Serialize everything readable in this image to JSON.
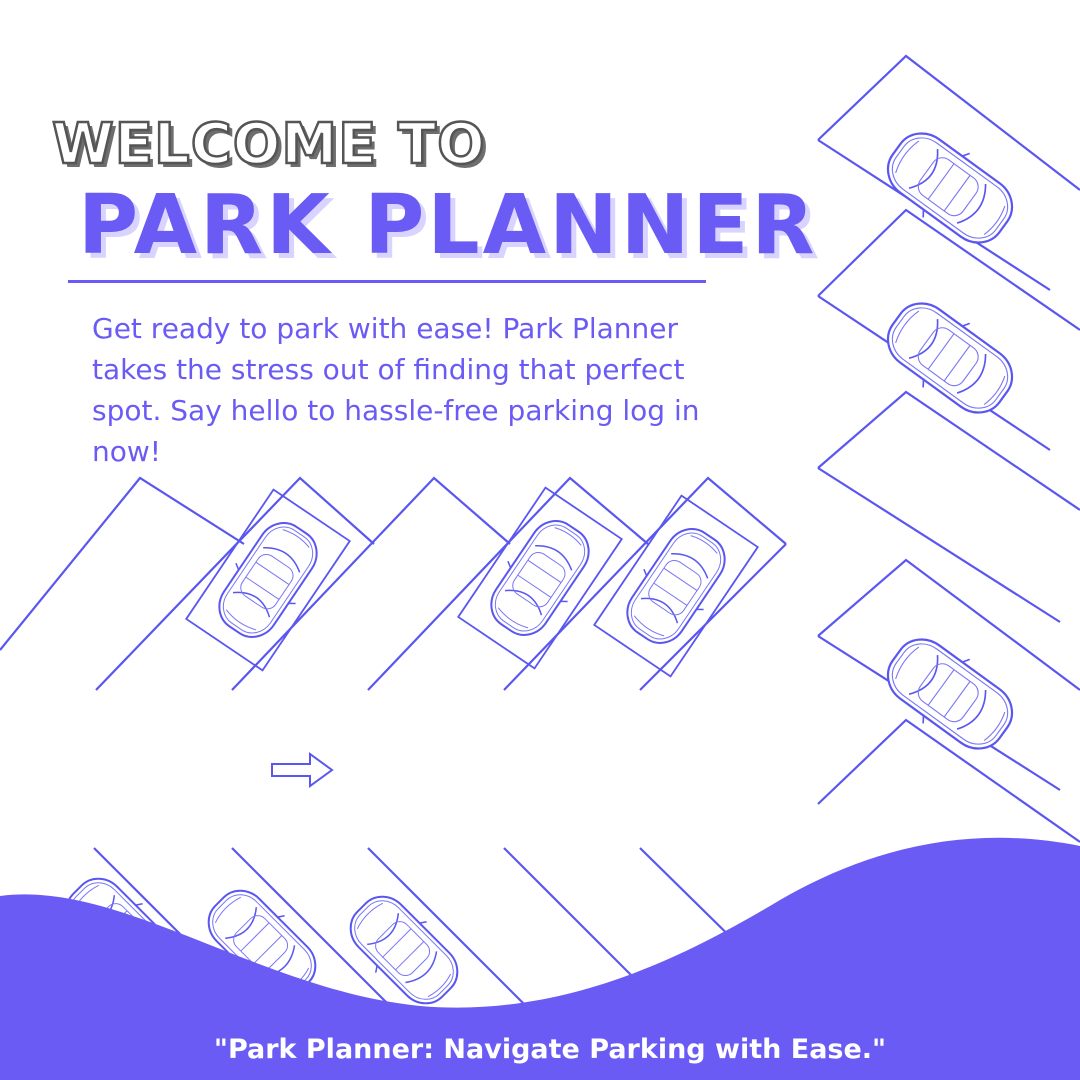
{
  "heading": {
    "welcome": "WELCOME TO",
    "title": "PARK PLANNER"
  },
  "intro": "Get ready to park with ease! Park Planner takes the stress out of finding that perfect spot. Say hello to hassle-free parking log in now!",
  "tagline": "\"Park Planner: Navigate Parking with Ease.\"",
  "theme": {
    "accent": "#6b5bf5",
    "line": "#5a56f0",
    "heading_gray": "#555555",
    "background": "#ffffff"
  },
  "icons": [
    "car-icon",
    "direction-arrow-icon"
  ]
}
